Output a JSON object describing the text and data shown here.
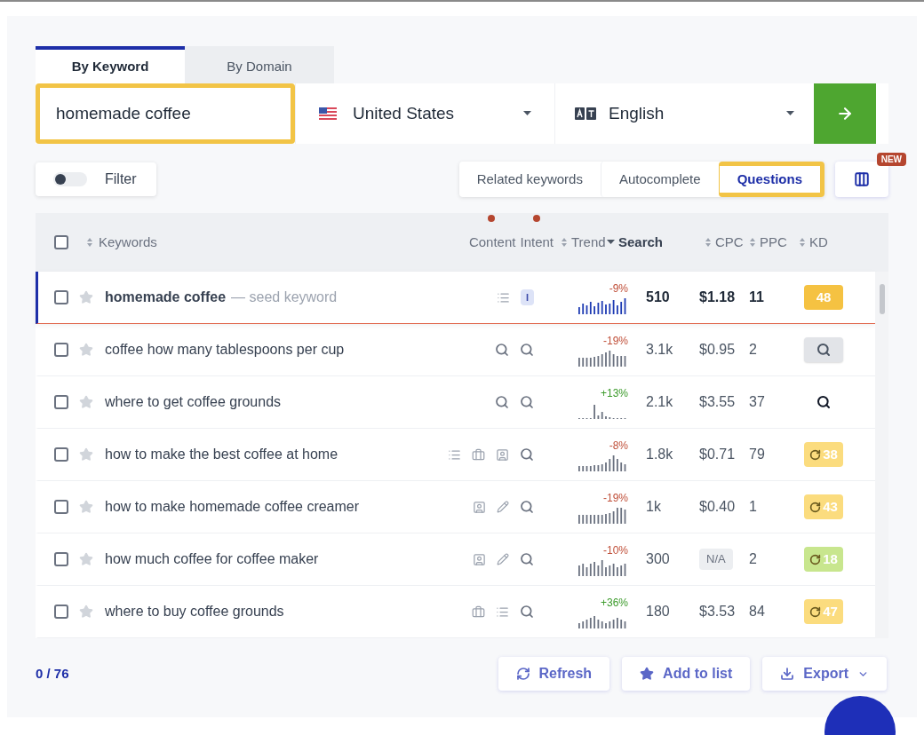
{
  "search_tabs": [
    {
      "label": "By Keyword",
      "selected": true
    },
    {
      "label": "By Domain",
      "selected": false
    }
  ],
  "query": {
    "value": "homemade coffee",
    "highlighted": true
  },
  "country": {
    "value": "United States"
  },
  "language": {
    "value": "English"
  },
  "filter": {
    "label": "Filter",
    "on": false
  },
  "modes": [
    {
      "label": "Related keywords",
      "selected": false,
      "highlighted": false
    },
    {
      "label": "Autocomplete",
      "selected": false,
      "highlighted": false
    },
    {
      "label": "Questions",
      "selected": true,
      "highlighted": true
    }
  ],
  "columns_badge": "NEW",
  "header": {
    "select_all_checked": false,
    "keywords": {
      "label": "Keywords",
      "sortable": true,
      "sorted": false
    },
    "content": {
      "label": "Content",
      "dot": true
    },
    "intent": {
      "label": "Intent",
      "dot": true
    },
    "trend": {
      "label": "Trend",
      "sortable": true,
      "sorted": false
    },
    "search": {
      "label": "Search",
      "sortable": true,
      "sorted": true
    },
    "cpc": {
      "label": "CPC",
      "sortable": true,
      "sorted": false
    },
    "ppc": {
      "label": "PPC",
      "sortable": true,
      "sorted": false
    },
    "kd": {
      "label": "KD",
      "sortable": true,
      "sorted": false
    }
  },
  "rows": [
    {
      "seed": true,
      "checked": false,
      "starred": false,
      "keyword": "homemade coffee",
      "note": "— seed keyword",
      "intent": [
        {
          "kind": "list"
        },
        {
          "kind": "letter",
          "text": "I"
        }
      ],
      "trend": "-9%",
      "trend_up": false,
      "search": "510",
      "cpc": "$1.18",
      "ppc": "11",
      "kd": {
        "kind": "score",
        "text": "48",
        "color": "#f5c242",
        "refresh": false
      }
    },
    {
      "seed": false,
      "checked": false,
      "starred": false,
      "keyword": "coffee how many tablespoons per cup",
      "intent": [
        {
          "kind": "search"
        },
        {
          "kind": "search"
        }
      ],
      "trend": "-19%",
      "trend_up": false,
      "search": "3.1k",
      "cpc": "$0.95",
      "ppc": "2",
      "kd": {
        "kind": "search",
        "boxed": true
      }
    },
    {
      "seed": false,
      "checked": false,
      "starred": false,
      "keyword": "where to get coffee grounds",
      "intent": [
        {
          "kind": "search"
        },
        {
          "kind": "search"
        }
      ],
      "trend": "+13%",
      "trend_up": true,
      "search": "2.1k",
      "cpc": "$3.55",
      "ppc": "37",
      "kd": {
        "kind": "search",
        "boxed": false
      }
    },
    {
      "seed": false,
      "checked": false,
      "starred": false,
      "keyword": "how to make the best coffee at home",
      "intent": [
        {
          "kind": "list"
        },
        {
          "kind": "briefcase"
        },
        {
          "kind": "portrait"
        },
        {
          "kind": "search"
        }
      ],
      "trend": "-8%",
      "trend_up": false,
      "search": "1.8k",
      "cpc": "$0.71",
      "ppc": "79",
      "kd": {
        "kind": "score",
        "text": "38",
        "color": "#fbdc7e",
        "refresh": true
      }
    },
    {
      "seed": false,
      "checked": false,
      "starred": false,
      "keyword": "how to make homemade coffee creamer",
      "intent": [
        {
          "kind": "portrait"
        },
        {
          "kind": "pencil"
        },
        {
          "kind": "search"
        }
      ],
      "trend": "-19%",
      "trend_up": false,
      "search": "1k",
      "cpc": "$0.40",
      "ppc": "1",
      "kd": {
        "kind": "score",
        "text": "43",
        "color": "#fbdc7e",
        "refresh": true
      }
    },
    {
      "seed": false,
      "checked": false,
      "starred": false,
      "keyword": "how much coffee for coffee maker",
      "intent": [
        {
          "kind": "portrait"
        },
        {
          "kind": "pencil"
        },
        {
          "kind": "search"
        }
      ],
      "trend": "-10%",
      "trend_up": false,
      "search": "300",
      "cpc": "N/A",
      "cpc_na": true,
      "ppc": "2",
      "kd": {
        "kind": "score",
        "text": "18",
        "color": "#c8e68e",
        "refresh": true
      }
    },
    {
      "seed": false,
      "checked": false,
      "starred": false,
      "keyword": "where to buy coffee grounds",
      "intent": [
        {
          "kind": "briefcase"
        },
        {
          "kind": "list"
        },
        {
          "kind": "search"
        }
      ],
      "trend": "+36%",
      "trend_up": true,
      "search": "180",
      "cpc": "$3.53",
      "ppc": "84",
      "kd": {
        "kind": "score",
        "text": "47",
        "color": "#fbdc7e",
        "refresh": true
      }
    }
  ],
  "footer": {
    "count": "0 / 76",
    "buttons": [
      {
        "kind": "refresh",
        "label": "Refresh"
      },
      {
        "kind": "star",
        "label": "Add to list"
      },
      {
        "kind": "export",
        "label": "Export"
      }
    ]
  }
}
